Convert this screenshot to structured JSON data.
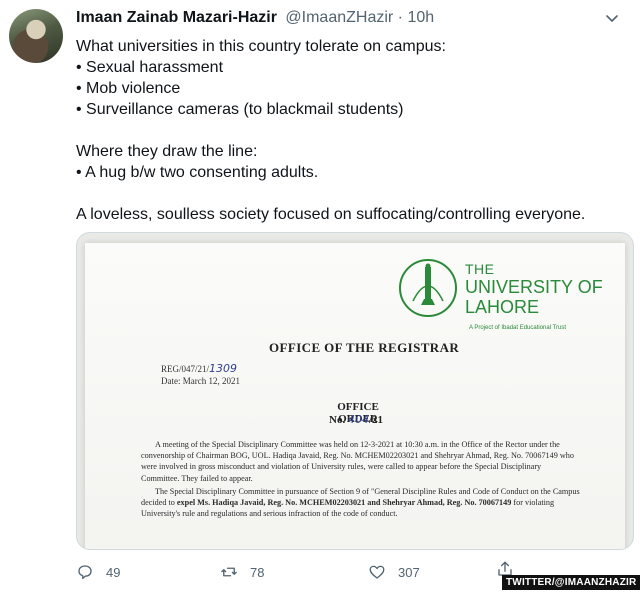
{
  "tweet": {
    "author_name": "Imaan Zainab Mazari-Hazir",
    "handle": "@ImaanZHazir",
    "time": " · 10h",
    "lines": [
      "What universities in this country tolerate on campus:",
      "• Sexual harassment",
      "• Mob violence",
      "• Surveillance cameras (to blackmail students)",
      "",
      "Where they draw the line:",
      "• A hug b/w two consenting adults.",
      "",
      "A loveless, soulless society focused on suffocating/controlling everyone."
    ]
  },
  "document": {
    "uni_the": "THE",
    "uni_name": "UNIVERSITY OF LAHORE",
    "uni_trust": "A Project of Ibadat Educational Trust",
    "heading": "OFFICE OF THE REGISTRAR",
    "ref_prefix": "REG/047/21/",
    "ref_hand": "1309",
    "date": "Date: March 12, 2021",
    "order_title": "OFFICE ORDER",
    "order_no_prefix": "No. ",
    "order_no_hand": "404",
    "order_no_suffix": "/21",
    "para1": "A meeting of the Special Disciplinary Committee was held on 12-3-2021 at 10:30 a.m. in the Office of the Rector under the convenorship of Chairman BOG, UOL. Hadiqa Javaid, Reg. No. MCHEM02203021 and Shehryar Ahmad, Reg. No. 70067149 who were involved in gross misconduct and violation of University rules, were called to appear before the Special Disciplinary Committee. They failed to appear.",
    "para2_a": "The Special Disciplinary Committee in pursuance of Section 9 of \"General Discipline Rules and Code of Conduct on the Campus decided to ",
    "para2_bold": "expel Ms. Hadiqa Javaid, Reg. No. MCHEM02203021 and Shehryar Ahmad, Reg. No. 70067149",
    "para2_b": " for violating University's rule and regulations and serious infraction of the code of conduct."
  },
  "actions": {
    "replies": "49",
    "retweets": "78",
    "likes": "307"
  },
  "watermark": "TWITTER/@IMAANZHAZIR"
}
